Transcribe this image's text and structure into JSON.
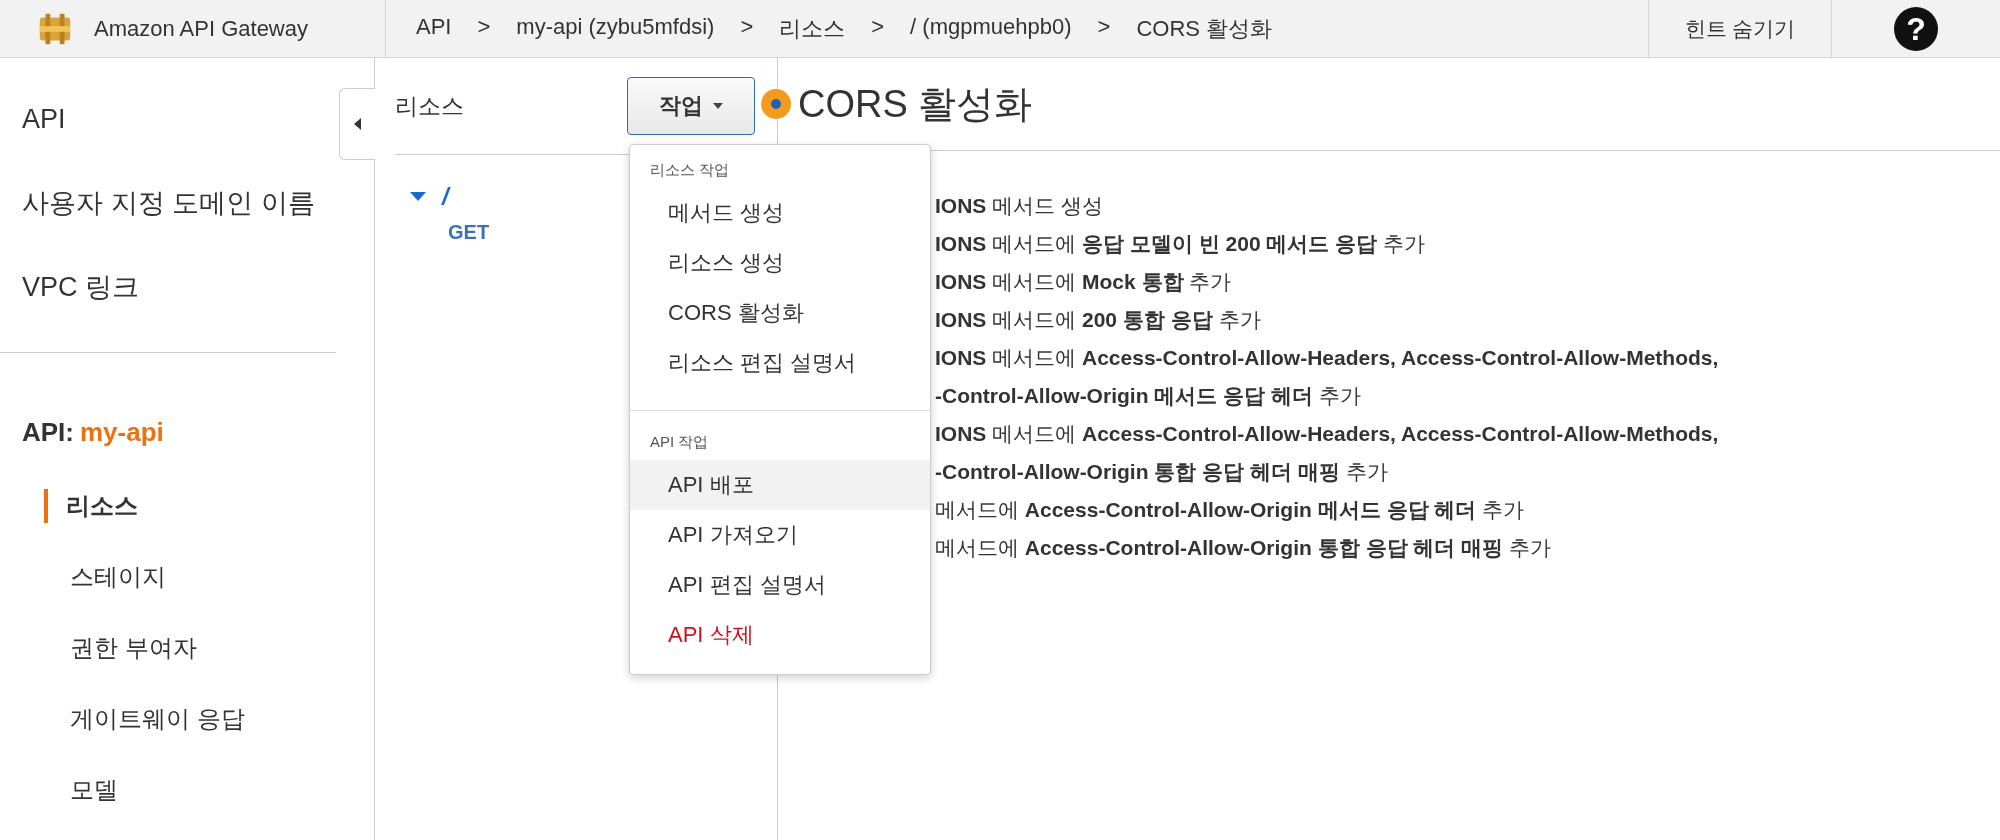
{
  "topbar": {
    "product": "Amazon API Gateway",
    "breadcrumb": [
      "API",
      ">",
      "my-api (zybu5mfdsi)",
      ">",
      "리소스",
      ">",
      "/ (mgpmuehpb0)",
      ">",
      "CORS 활성화"
    ],
    "hint_toggle": "힌트 숨기기",
    "help": "?"
  },
  "sidebar": {
    "top_items": [
      "API",
      "사용자 지정 도메인 이름",
      "VPC 링크"
    ],
    "api_label": "API:",
    "api_name": "my-api",
    "items": [
      {
        "label": "리소스",
        "selected": true
      },
      {
        "label": "스테이지",
        "selected": false
      },
      {
        "label": "권한 부여자",
        "selected": false
      },
      {
        "label": "게이트웨이 응답",
        "selected": false
      },
      {
        "label": "모델",
        "selected": false
      }
    ]
  },
  "resources": {
    "title": "리소스",
    "actions_button": "작업",
    "tree": [
      {
        "label": "/",
        "expanded": true,
        "children": [
          {
            "label": "GET"
          }
        ]
      }
    ]
  },
  "actions_menu": {
    "groups": [
      {
        "heading": "리소스 작업",
        "items": [
          {
            "label": "메서드 생성",
            "kind": "normal",
            "selected": false
          },
          {
            "label": "리소스 생성",
            "kind": "normal",
            "selected": false
          },
          {
            "label": "CORS 활성화",
            "kind": "normal",
            "selected": false
          },
          {
            "label": "리소스 편집 설명서",
            "kind": "normal",
            "selected": false
          }
        ]
      },
      {
        "heading": "API 작업",
        "items": [
          {
            "label": "API 배포",
            "kind": "normal",
            "selected": true
          },
          {
            "label": "API 가져오기",
            "kind": "normal",
            "selected": false
          },
          {
            "label": "API 편집 설명서",
            "kind": "normal",
            "selected": false
          },
          {
            "label": "API 삭제",
            "kind": "danger",
            "selected": false
          }
        ]
      }
    ]
  },
  "main": {
    "title": "CORS 활성화",
    "lines": [
      "**IONS** 메서드 생성",
      "**IONS** 메서드에 **응답 모델이 빈 200 메서드 응답** 추가",
      "**IONS** 메서드에 **Mock 통합** 추가",
      "**IONS** 메서드에 **200 통합 응답** 추가",
      "**IONS** 메서드에 **Access-Control-Allow-Headers, Access-Control-Allow-Methods,**",
      "**-Control-Allow-Origin 메서드 응답 헤더** 추가",
      "**IONS** 메서드에 **Access-Control-Allow-Headers, Access-Control-Allow-Methods,**",
      "**-Control-Allow-Origin 통합 응답 헤더 매핑** 추가",
      "메서드에 **Access-Control-Allow-Origin 메서드 응답 헤더** 추가",
      "메서드에 **Access-Control-Allow-Origin 통합 응답 헤더 매핑** 추가"
    ]
  }
}
